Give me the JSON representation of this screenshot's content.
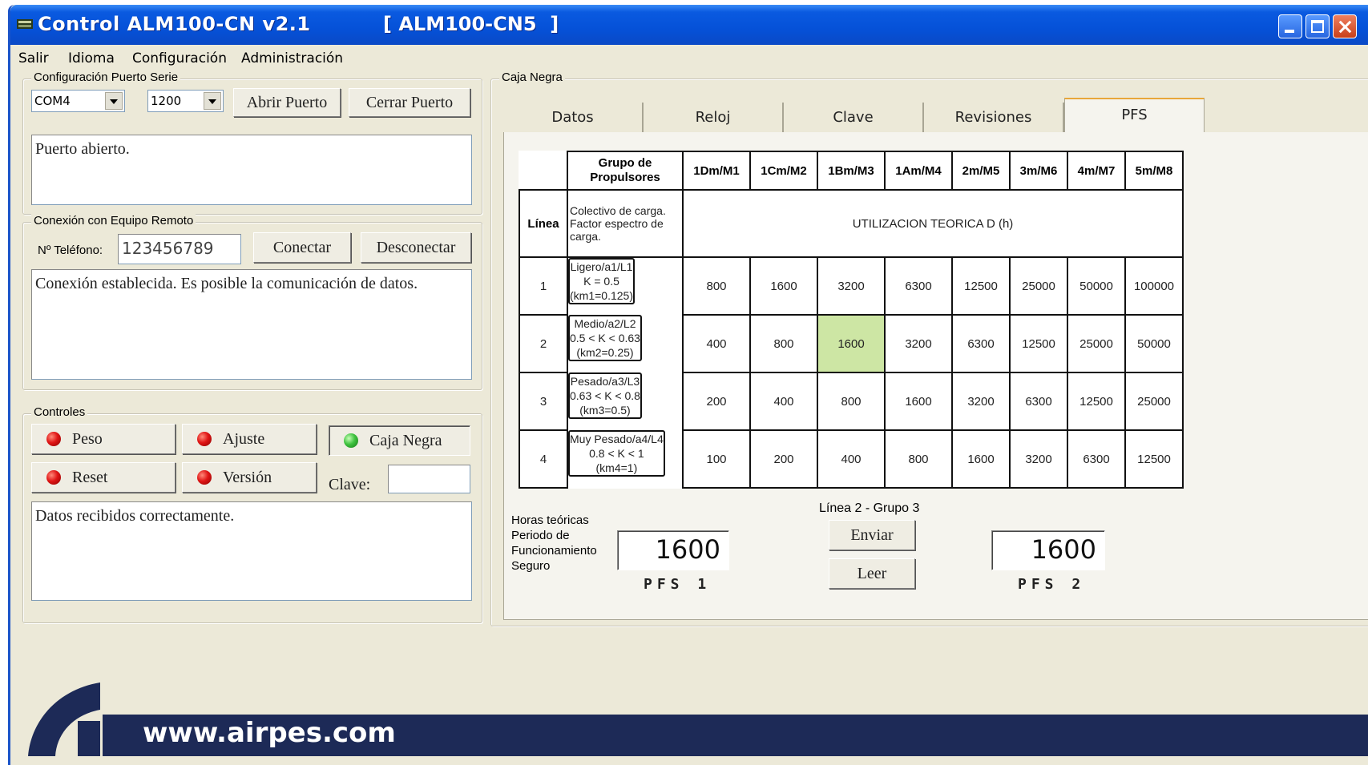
{
  "window": {
    "title": "Control ALM100-CN v2.1",
    "device": "[ ALM100-CN5  ]"
  },
  "menu": [
    "Salir",
    "Idioma",
    "Configuración",
    "Administración"
  ],
  "serial": {
    "group_label": "Configuración Puerto Serie",
    "port": "COM4",
    "baud": "1200",
    "open_label": "Abrir Puerto",
    "close_label": "Cerrar Puerto",
    "status": "Puerto abierto."
  },
  "remote": {
    "group_label": "Conexión con Equipo Remoto",
    "phone_label": "Nº Teléfono:",
    "phone": "123456789",
    "connect_label": "Conectar",
    "disconnect_label": "Desconectar",
    "status": "Conexión establecida. Es posible la comunicación de datos."
  },
  "controls": {
    "group_label": "Controles",
    "peso": "Peso",
    "ajuste": "Ajuste",
    "caja_negra": "Caja Negra",
    "reset": "Reset",
    "version": "Versión",
    "clave_label": "Clave:",
    "clave_value": "",
    "status": "Datos recibidos correctamente."
  },
  "caja_negra": {
    "group_label": "Caja Negra",
    "tabs": [
      "Datos",
      "Reloj",
      "Clave",
      "Revisiones",
      "PFS"
    ],
    "active_tab": "PFS",
    "table": {
      "group_header": "Grupo de Propulsores",
      "columns": [
        "1Dm/M1",
        "1Cm/M2",
        "1Bm/M3",
        "1Am/M4",
        "2m/M5",
        "3m/M6",
        "4m/M7",
        "5m/M8"
      ],
      "line_header": "Línea",
      "load_desc": "Colectivo de carga. Factor espectro de carga.",
      "utilization": "UTILIZACION TEORICA D (h)",
      "rows": [
        {
          "line": "1",
          "l1": "Ligero/a1/L1",
          "l2": "K = 0.5",
          "l3": "(km1=0.125)",
          "values": [
            "800",
            "1600",
            "3200",
            "6300",
            "12500",
            "25000",
            "50000",
            "100000"
          ]
        },
        {
          "line": "2",
          "l1": "Medio/a2/L2",
          "l2": "0.5 < K < 0.63",
          "l3": "(km2=0.25)",
          "values": [
            "400",
            "800",
            "1600",
            "3200",
            "6300",
            "12500",
            "25000",
            "50000"
          ]
        },
        {
          "line": "3",
          "l1": "Pesado/a3/L3",
          "l2": "0.63 < K < 0.8",
          "l3": "(km3=0.5)",
          "values": [
            "200",
            "400",
            "800",
            "1600",
            "3200",
            "6300",
            "12500",
            "25000"
          ]
        },
        {
          "line": "4",
          "l1": "Muy Pesado/a4/L4",
          "l2": "0.8 < K < 1",
          "l3": "(km4=1)",
          "values": [
            "100",
            "200",
            "400",
            "800",
            "1600",
            "3200",
            "6300",
            "12500"
          ]
        }
      ]
    },
    "hours_label": [
      "Horas teóricas",
      "Periodo de",
      "Funcionamiento",
      "Seguro"
    ],
    "selection": "Línea 2 - Grupo 3",
    "send_label": "Enviar",
    "read_label": "Leer",
    "pfs1_value": "1600",
    "pfs1_label": "PFS 1",
    "pfs2_value": "1600",
    "pfs2_label": "PFS 2"
  },
  "footer": {
    "url": "www.airpes.com"
  },
  "colors": {
    "titlebar": "#0551d8",
    "highlight_cell": "#cde6a4",
    "footer": "#1d2a57",
    "led_red": "#e01515",
    "led_green": "#3fc23f"
  }
}
